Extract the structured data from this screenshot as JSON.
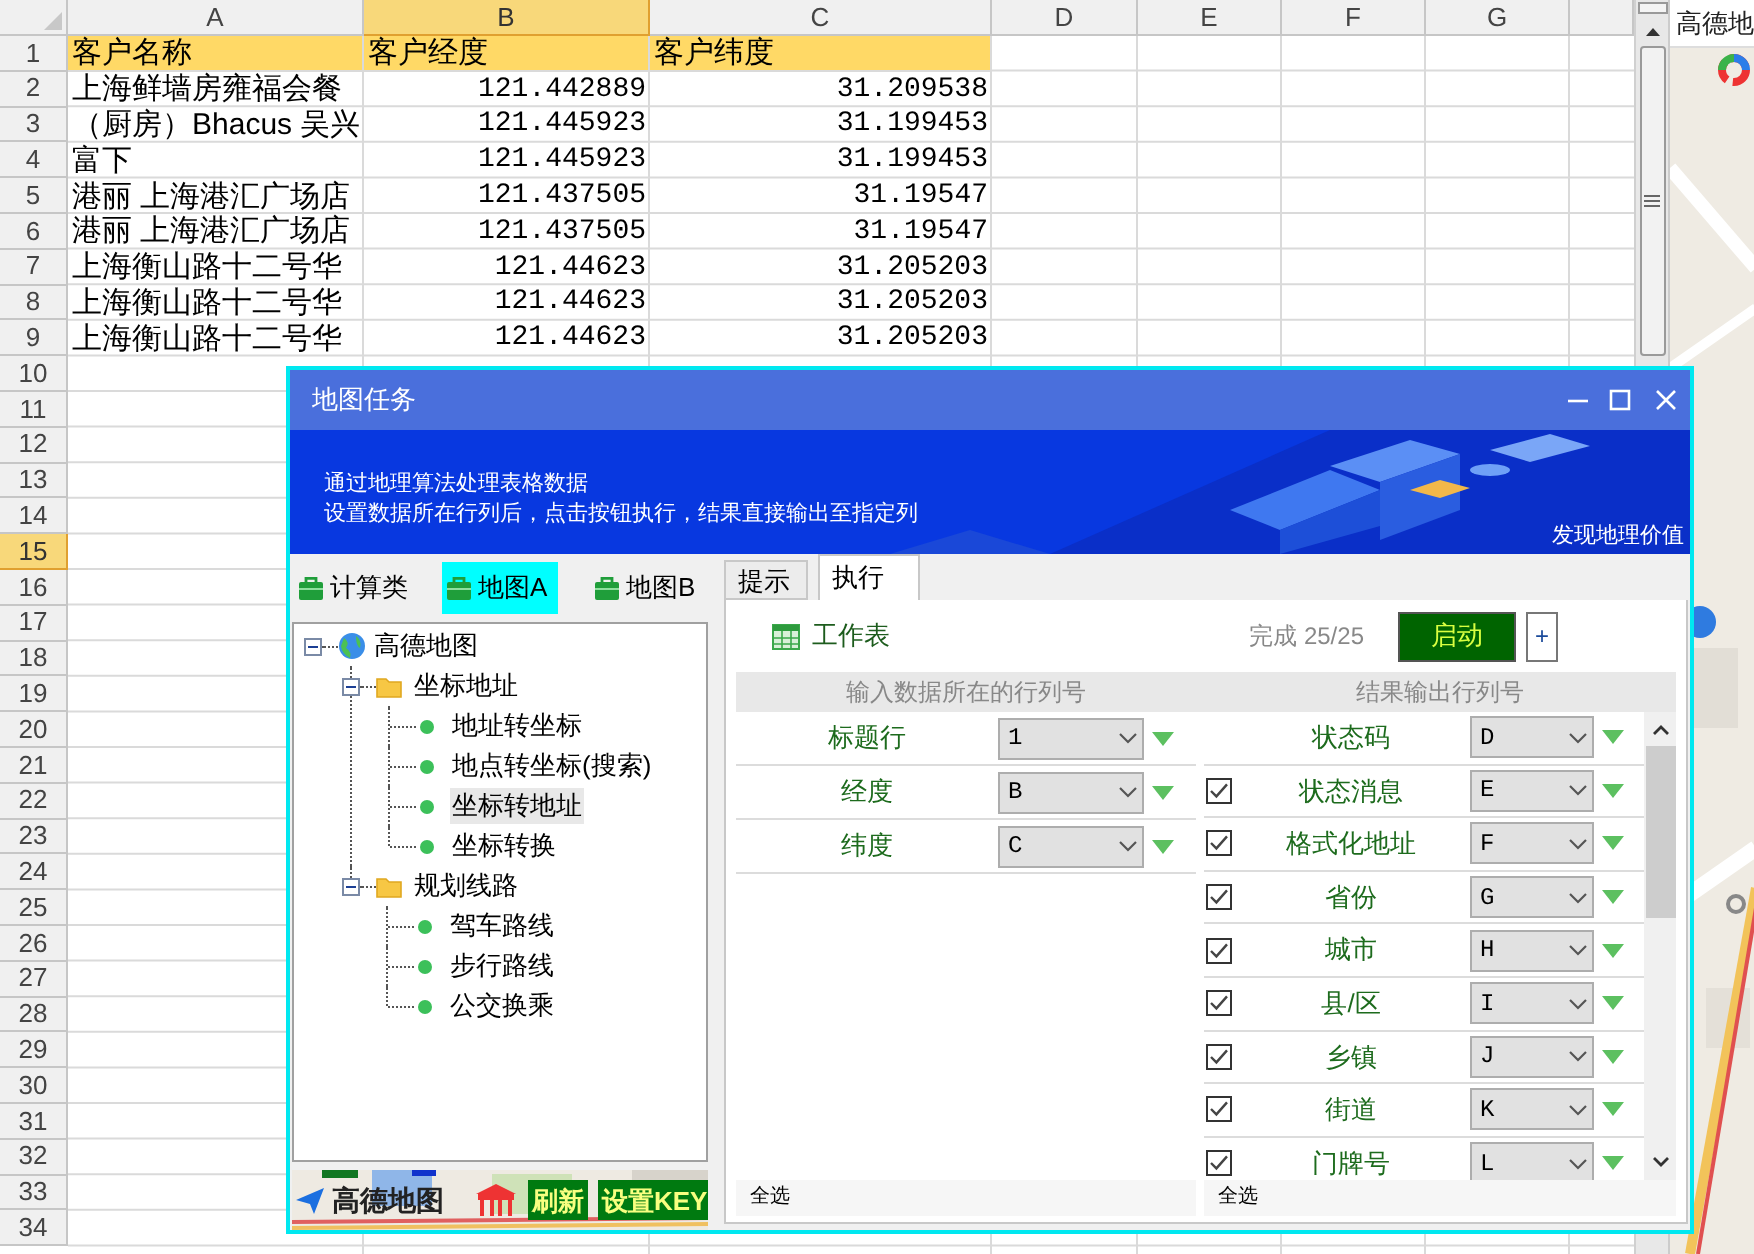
{
  "spreadsheet": {
    "column_headers": [
      {
        "label": "A",
        "selected": false
      },
      {
        "label": "B",
        "selected": true
      },
      {
        "label": "C",
        "selected": false
      },
      {
        "label": "D",
        "selected": false
      },
      {
        "label": "E",
        "selected": false
      },
      {
        "label": "F",
        "selected": false
      },
      {
        "label": "G",
        "selected": false
      }
    ],
    "row_headers": [
      {
        "label": "1",
        "selected": false
      },
      {
        "label": "2",
        "selected": false
      },
      {
        "label": "3",
        "selected": false
      },
      {
        "label": "4",
        "selected": false
      },
      {
        "label": "5",
        "selected": false
      },
      {
        "label": "6",
        "selected": false
      },
      {
        "label": "7",
        "selected": false
      },
      {
        "label": "8",
        "selected": false
      },
      {
        "label": "9",
        "selected": false
      },
      {
        "label": "10",
        "selected": false
      },
      {
        "label": "11",
        "selected": false
      },
      {
        "label": "12",
        "selected": false
      },
      {
        "label": "13",
        "selected": false
      },
      {
        "label": "14",
        "selected": false
      },
      {
        "label": "15",
        "selected": true
      },
      {
        "label": "16",
        "selected": false
      },
      {
        "label": "17",
        "selected": false
      },
      {
        "label": "18",
        "selected": false
      },
      {
        "label": "19",
        "selected": false
      },
      {
        "label": "20",
        "selected": false
      },
      {
        "label": "21",
        "selected": false
      },
      {
        "label": "22",
        "selected": false
      },
      {
        "label": "23",
        "selected": false
      },
      {
        "label": "24",
        "selected": false
      },
      {
        "label": "25",
        "selected": false
      },
      {
        "label": "26",
        "selected": false
      },
      {
        "label": "27",
        "selected": false
      },
      {
        "label": "28",
        "selected": false
      },
      {
        "label": "29",
        "selected": false
      },
      {
        "label": "30",
        "selected": false
      },
      {
        "label": "31",
        "selected": false
      },
      {
        "label": "32",
        "selected": false
      },
      {
        "label": "33",
        "selected": false
      },
      {
        "label": "34",
        "selected": false
      }
    ],
    "table": {
      "columns": [
        "客户名称",
        "客户经度",
        "客户纬度"
      ],
      "rows": [
        [
          "上海鲜墙房雍福会餐",
          "121.442889",
          "31.209538"
        ],
        [
          "（厨房）Bhacus 吴兴",
          "121.445923",
          "31.199453"
        ],
        [
          "富下",
          "121.445923",
          "31.199453"
        ],
        [
          "港丽 上海港汇广场店",
          "121.437505",
          "31.19547"
        ],
        [
          "港丽 上海港汇广场店",
          "121.437505",
          "31.19547"
        ],
        [
          "上海衡山路十二号华",
          "121.44623",
          "31.205203"
        ],
        [
          "上海衡山路十二号华",
          "121.44623",
          "31.205203"
        ],
        [
          "上海衡山路十二号华",
          "121.44623",
          "31.205203"
        ]
      ]
    }
  },
  "map_panel": {
    "title": "高德地"
  },
  "dialog": {
    "title": "地图任务",
    "banner": {
      "lines": [
        "通过地理算法处理表格数据",
        "设置数据所在行列后，点击按钮执行，结果直接输出至指定列"
      ],
      "slogan": "发现地理价值"
    },
    "category_tabs": [
      {
        "label": "计算类",
        "selected": false
      },
      {
        "label": "地图A",
        "selected": true
      },
      {
        "label": "地图B",
        "selected": false
      }
    ],
    "tree": [
      {
        "label": "高德地图",
        "expanded": true,
        "selected": false,
        "children": [
          {
            "label": "坐标地址",
            "expanded": true,
            "selected": false,
            "children": [
              {
                "label": "地址转坐标",
                "selected": false
              },
              {
                "label": "地点转坐标(搜索)",
                "selected": false
              },
              {
                "label": "坐标转地址",
                "selected": true
              },
              {
                "label": "坐标转换",
                "selected": false
              }
            ]
          },
          {
            "label": "规划线路",
            "expanded": true,
            "selected": false,
            "children": [
              {
                "label": "驾车路线",
                "selected": false
              },
              {
                "label": "步行路线",
                "selected": false
              },
              {
                "label": "公交换乘",
                "selected": false
              }
            ]
          }
        ]
      }
    ],
    "map_logo": "高德地图",
    "footer_buttons": [
      "刷新",
      "设置KEY"
    ],
    "tabs": [
      {
        "label": "提示",
        "selected": false
      },
      {
        "label": "执行",
        "selected": true
      }
    ],
    "sheet_label": "工作表",
    "progress": "完成 25/25",
    "start_button": "启动",
    "add_button": "+",
    "input_section": {
      "title": "输入数据所在的行列号",
      "select_all": "全选",
      "rows": [
        {
          "label": "标题行",
          "value": "1"
        },
        {
          "label": "经度",
          "value": "B"
        },
        {
          "label": "纬度",
          "value": "C"
        }
      ]
    },
    "output_section": {
      "title": "结果输出行列号",
      "select_all": "全选",
      "rows": [
        {
          "kind": "plain",
          "label": "状态码",
          "value": "D"
        },
        {
          "kind": "check",
          "checked": true,
          "label": "状态消息",
          "value": "E"
        },
        {
          "kind": "check",
          "checked": true,
          "label": "格式化地址",
          "value": "F"
        },
        {
          "kind": "check",
          "checked": true,
          "label": "省份",
          "value": "G"
        },
        {
          "kind": "check",
          "checked": true,
          "label": "城市",
          "value": "H"
        },
        {
          "kind": "check",
          "checked": true,
          "label": "县/区",
          "value": "I"
        },
        {
          "kind": "check",
          "checked": true,
          "label": "乡镇",
          "value": "J"
        },
        {
          "kind": "check",
          "checked": true,
          "label": "街道",
          "value": "K"
        },
        {
          "kind": "check",
          "checked": true,
          "label": "门牌号",
          "value": "L"
        }
      ]
    }
  }
}
